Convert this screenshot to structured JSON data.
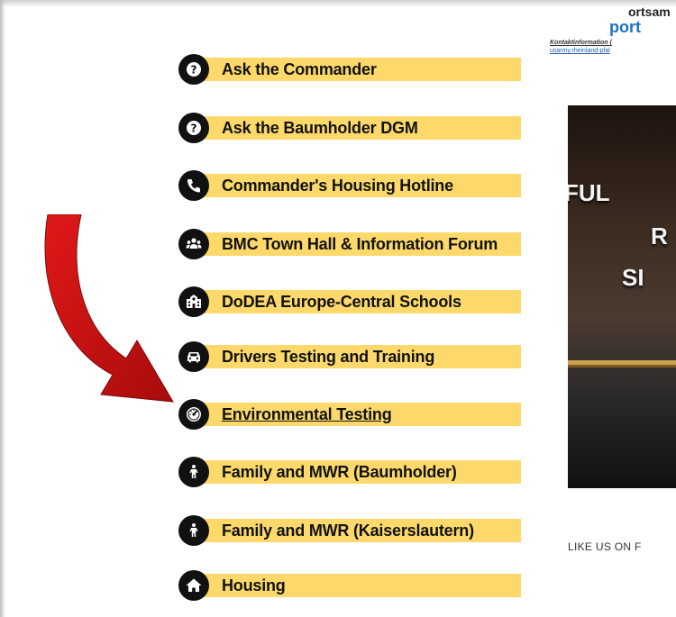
{
  "links": [
    {
      "label": "Ask the Commander",
      "icon": "question-icon"
    },
    {
      "label": "Ask the Baumholder DGM",
      "icon": "question-icon"
    },
    {
      "label": "Commander's Housing Hotline",
      "icon": "phone-icon"
    },
    {
      "label": "BMC Town Hall & Information Forum",
      "icon": "people-icon"
    },
    {
      "label": "DoDEA Europe-Central Schools",
      "icon": "school-icon"
    },
    {
      "label": "Drivers Testing and Training",
      "icon": "car-icon"
    },
    {
      "label": "Environmental Testing",
      "icon": "gauge-icon"
    },
    {
      "label": "Family and MWR (Baumholder)",
      "icon": "child-icon"
    },
    {
      "label": "Family and MWR (Kaiserslautern)",
      "icon": "child-icon"
    },
    {
      "label": "Housing",
      "icon": "home-icon"
    }
  ],
  "highlighted_link": "Environmental Testing",
  "right_column": {
    "ortsamt_text": "ortsam",
    "portal_text": "port",
    "contact_text": "Kontaktinformation (",
    "contact_url": "usarmy.rheinland-pfal",
    "promo_lines": [
      "FUL",
      "R",
      "SI"
    ],
    "like_text": "LIKE US ON F"
  },
  "colors": {
    "link_bar": "#fcd96a",
    "icon_circle": "#111111",
    "arrow": "#c20f0f",
    "portal": "#1a72c4"
  }
}
